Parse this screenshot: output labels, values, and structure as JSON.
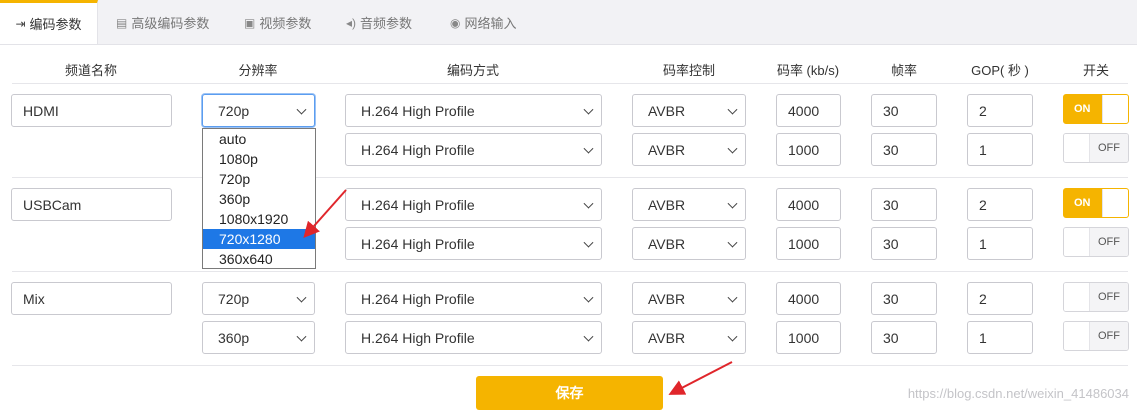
{
  "tabs": [
    {
      "label": "编码参数",
      "icon": "login-arrow-icon"
    },
    {
      "label": "高级编码参数",
      "icon": "document-icon"
    },
    {
      "label": "视频参数",
      "icon": "image-icon"
    },
    {
      "label": "音频参数",
      "icon": "speaker-icon"
    },
    {
      "label": "网络输入",
      "icon": "globe-icon"
    }
  ],
  "headers": [
    "频道名称",
    "分辨率",
    "编码方式",
    "码率控制",
    "码率 (kb/s)",
    "帧率",
    "GOP( 秒 )",
    "开关"
  ],
  "channels": [
    {
      "name": "HDMI",
      "streams": [
        {
          "resolution": "720p",
          "codec": "H.264 High Profile",
          "rc": "AVBR",
          "bitrate": "4000",
          "fps": "30",
          "gop": "2",
          "switch": "ON"
        },
        {
          "resolution": "",
          "codec": "H.264 High Profile",
          "rc": "AVBR",
          "bitrate": "1000",
          "fps": "30",
          "gop": "1",
          "switch": "OFF"
        }
      ]
    },
    {
      "name": "USBCam",
      "streams": [
        {
          "resolution": "",
          "codec": "H.264 High Profile",
          "rc": "AVBR",
          "bitrate": "4000",
          "fps": "30",
          "gop": "2",
          "switch": "ON"
        },
        {
          "resolution": "",
          "codec": "H.264 High Profile",
          "rc": "AVBR",
          "bitrate": "1000",
          "fps": "30",
          "gop": "1",
          "switch": "OFF"
        }
      ]
    },
    {
      "name": "Mix",
      "streams": [
        {
          "resolution": "720p",
          "codec": "H.264 High Profile",
          "rc": "AVBR",
          "bitrate": "4000",
          "fps": "30",
          "gop": "2",
          "switch": "OFF"
        },
        {
          "resolution": "360p",
          "codec": "H.264 High Profile",
          "rc": "AVBR",
          "bitrate": "1000",
          "fps": "30",
          "gop": "1",
          "switch": "OFF"
        }
      ]
    }
  ],
  "resolution_options": [
    "auto",
    "1080p",
    "720p",
    "360p",
    "1080x1920",
    "720x1280",
    "360x640"
  ],
  "highlighted_option": "720x1280",
  "save_label": "保存",
  "watermark": "https://blog.csdn.net/weixin_41486034",
  "colors": {
    "accent": "#f5b400",
    "highlight": "#1e78e6",
    "arrow": "#e0262b"
  }
}
